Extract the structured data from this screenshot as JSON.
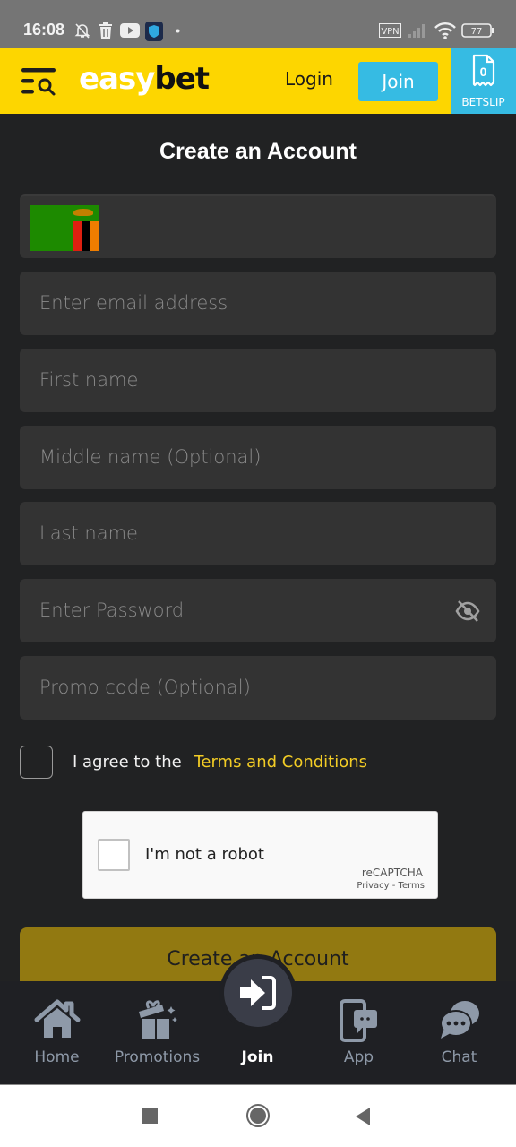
{
  "status_bar": {
    "time": "16:08",
    "icons": [
      "bell-off-icon",
      "trash-icon",
      "youtube-icon",
      "vpn-shield-app-icon",
      "dot-icon"
    ],
    "right_icons": [
      "vpn-badge-icon",
      "signal-icon",
      "wifi-icon",
      "battery-icon"
    ],
    "vpn_label": "VPN",
    "battery": "77"
  },
  "header": {
    "logo_part1": "easy",
    "logo_part2": "bet",
    "login_label": "Login",
    "join_label": "Join",
    "betslip_label": "BETSLIP",
    "betslip_count": "0",
    "colors": {
      "brand_yellow": "#fdd600",
      "accent_blue": "#36bbe3"
    }
  },
  "form": {
    "title": "Create an Account",
    "country_flag": "zambia-flag",
    "fields": [
      {
        "name": "email",
        "placeholder": "Enter email address",
        "value": ""
      },
      {
        "name": "first-name",
        "placeholder": "First name",
        "value": ""
      },
      {
        "name": "middle-name",
        "placeholder": "Middle name (Optional)",
        "value": ""
      },
      {
        "name": "last-name",
        "placeholder": "Last name",
        "value": ""
      },
      {
        "name": "password",
        "placeholder": "Enter Password",
        "value": ""
      },
      {
        "name": "promo-code",
        "placeholder": "Promo code (Optional)",
        "value": ""
      }
    ],
    "agree_text": "I agree to the",
    "terms_link": "Terms and Conditions",
    "agree_checked": false,
    "captcha": {
      "label": "I'm not a robot",
      "brand": "reCAPTCHA",
      "privacy": "Privacy",
      "separator": " - ",
      "terms": "Terms"
    },
    "submit_label": "Create an Account"
  },
  "bottom_nav": {
    "items": [
      {
        "label": "Home",
        "icon": "home-icon",
        "active": false
      },
      {
        "label": "Promotions",
        "icon": "gift-icon",
        "active": false
      },
      {
        "label": "Join",
        "icon": "sign-in-icon",
        "active": true
      },
      {
        "label": "App",
        "icon": "mobile-chat-icon",
        "active": false
      },
      {
        "label": "Chat",
        "icon": "chat-bubbles-icon",
        "active": false
      }
    ]
  },
  "system_nav": [
    "recents-button",
    "home-button",
    "back-button"
  ]
}
